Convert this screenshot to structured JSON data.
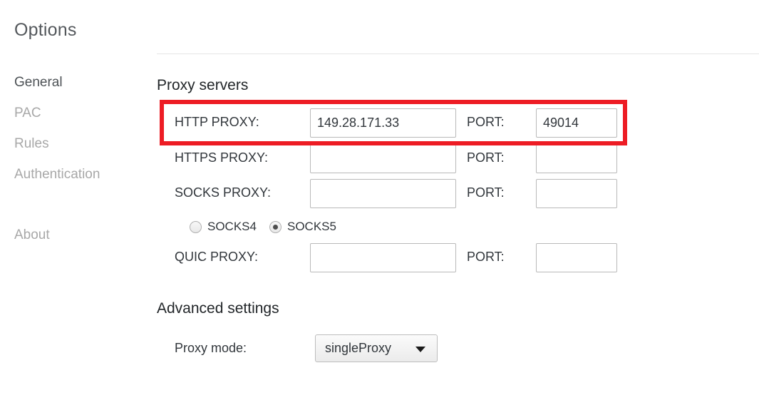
{
  "app": {
    "title": "Options"
  },
  "sidebar": {
    "items": [
      {
        "label": "General",
        "active": true
      },
      {
        "label": "PAC",
        "active": false
      },
      {
        "label": "Rules",
        "active": false
      },
      {
        "label": "Authentication",
        "active": false
      }
    ],
    "footer_items": [
      {
        "label": "About",
        "active": false
      }
    ]
  },
  "main": {
    "sections": {
      "proxy_servers": {
        "heading": "Proxy servers",
        "rows": [
          {
            "label": "HTTP PROXY:",
            "host_value": "149.28.171.33",
            "host_placeholder": "",
            "port_label": "PORT:",
            "port_value": "49014",
            "port_placeholder": "",
            "highlighted": true
          },
          {
            "label": "HTTPS PROXY:",
            "host_value": "",
            "host_placeholder": "",
            "port_label": "PORT:",
            "port_value": "",
            "port_placeholder": "",
            "highlighted": false
          },
          {
            "label": "SOCKS PROXY:",
            "host_value": "",
            "host_placeholder": "",
            "port_label": "PORT:",
            "port_value": "",
            "port_placeholder": "",
            "highlighted": false
          },
          {
            "label": "QUIC PROXY:",
            "host_value": "",
            "host_placeholder": "",
            "port_label": "PORT:",
            "port_value": "",
            "port_placeholder": "",
            "highlighted": false
          }
        ],
        "socks_version": {
          "options": [
            {
              "label": "SOCKS4",
              "selected": false
            },
            {
              "label": "SOCKS5",
              "selected": true
            }
          ]
        }
      },
      "advanced_settings": {
        "heading": "Advanced settings",
        "proxy_mode": {
          "label": "Proxy mode:",
          "selected": "singleProxy",
          "caret_icon": "chevron-down-icon"
        }
      }
    }
  },
  "annotation": {
    "highlight_color": "#ED1C24",
    "highlight_target": "HTTP PROXY row"
  },
  "colors": {
    "accent_red": "#ED1C24",
    "active_nav": "#4d5256",
    "inactive_nav": "#a8a8a8",
    "text": "#31363b",
    "divider": "#e6e6e6"
  }
}
